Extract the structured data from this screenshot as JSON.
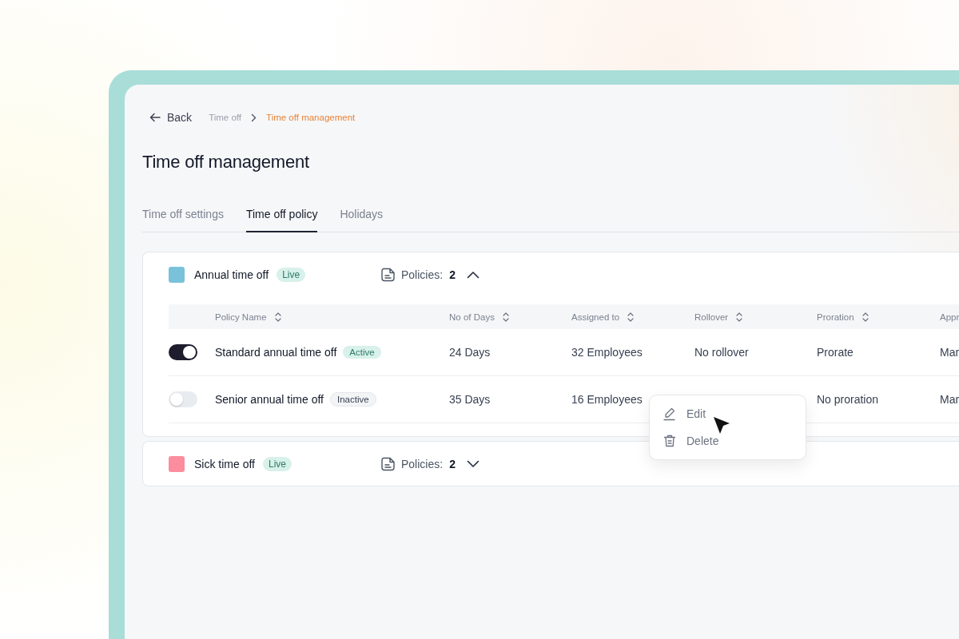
{
  "breadcrumb": {
    "back": "Back",
    "items": [
      {
        "label": "Time off",
        "current": false
      },
      {
        "label": "Time off management",
        "current": true
      }
    ]
  },
  "title": "Time off management",
  "tabs": [
    {
      "label": "Time off settings",
      "selected": false
    },
    {
      "label": "Time off policy",
      "selected": true
    },
    {
      "label": "Holidays",
      "selected": false
    }
  ],
  "groups": [
    {
      "name": "Annual time off",
      "color": "#79c2d9",
      "status": "Live",
      "policies_label": "Policies:",
      "count": "2",
      "expanded": true,
      "columns": [
        "Policy Name",
        "No of Days",
        "Assigned to",
        "Rollover",
        "Proration",
        "Appr"
      ],
      "rows": [
        {
          "on": true,
          "badge": "Active",
          "active": true,
          "cells": [
            "Standard annual time off",
            "24 Days",
            "32 Employees",
            "No rollover",
            "Prorate",
            "Mar"
          ]
        },
        {
          "on": false,
          "badge": "Inactive",
          "active": false,
          "cells": [
            "Senior annual time off",
            "35 Days",
            "16 Employees",
            "",
            "No proration",
            "Mar"
          ]
        }
      ]
    },
    {
      "name": "Sick time off",
      "color": "#fb8d9e",
      "status": "Live",
      "policies_label": "Policies:",
      "count": "2",
      "expanded": false
    }
  ],
  "menu": {
    "items": [
      {
        "label": "Edit",
        "kind": "edit"
      },
      {
        "label": "Delete",
        "kind": "delete"
      }
    ]
  }
}
